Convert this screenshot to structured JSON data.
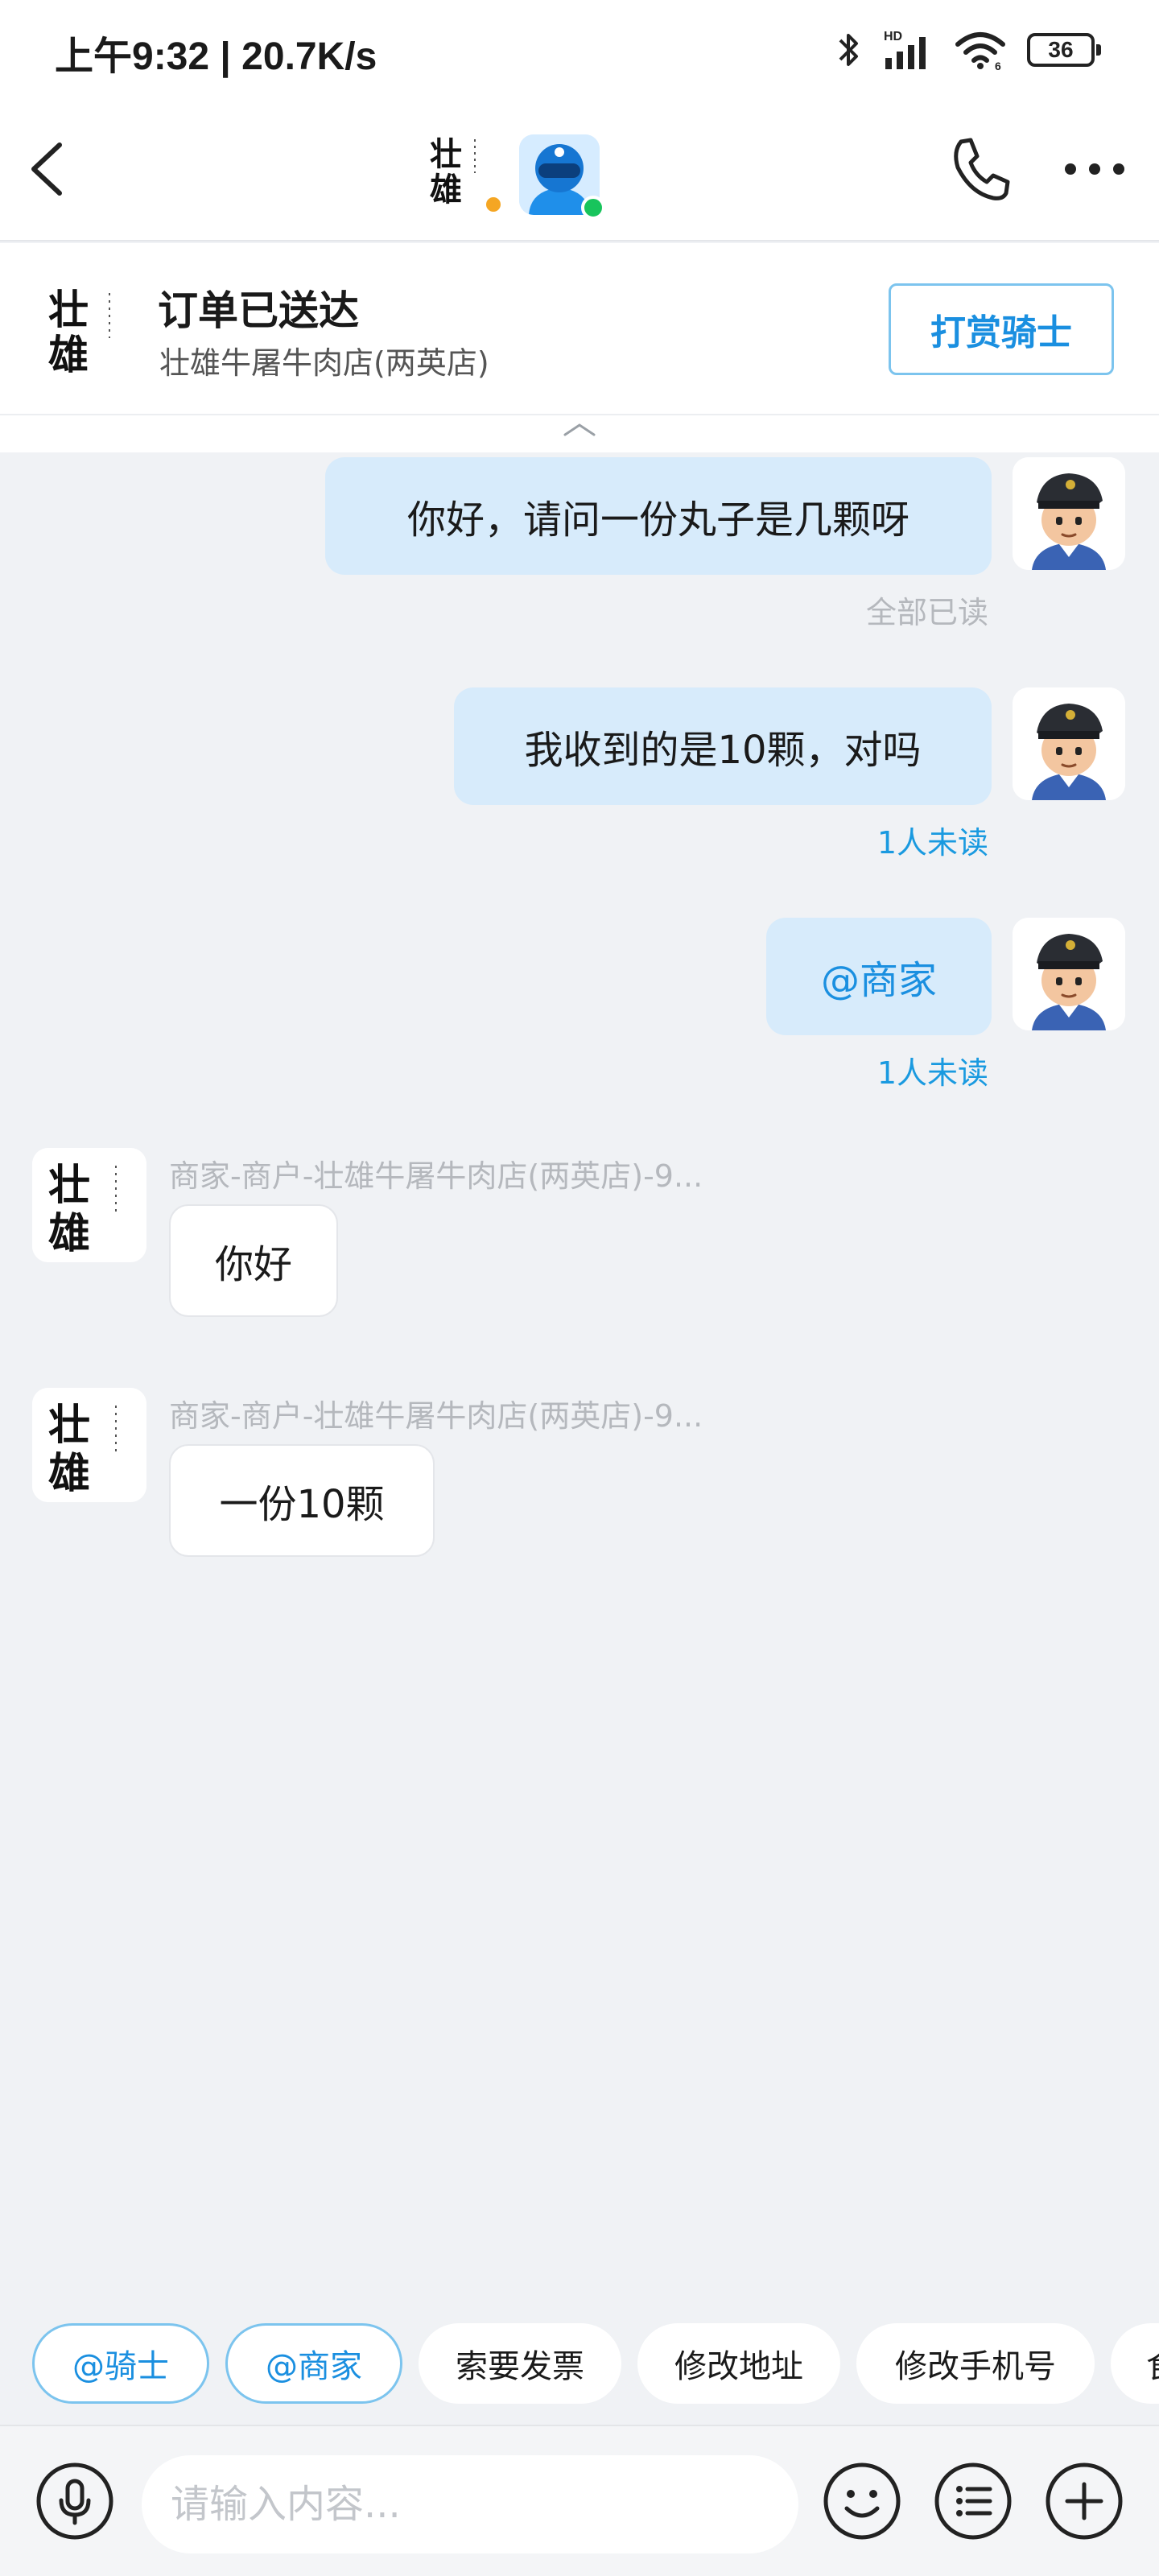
{
  "status_bar": {
    "time_text": "上午9:32 | 20.7K/s",
    "battery_level": "36",
    "icons": [
      "bluetooth-icon",
      "signal-hd-icon",
      "wifi-icon",
      "battery-icon"
    ]
  },
  "header": {
    "store_logo_text": "壮雄",
    "merchant_status": "busy",
    "rider_status": "online",
    "icons": [
      "back-icon",
      "phone-icon",
      "more-icon"
    ]
  },
  "order_card": {
    "logo_text": "壮雄",
    "status_title": "订单已送达",
    "store_name": "壮雄牛屠牛肉店(两英店)",
    "tip_button_label": "打赏骑士"
  },
  "messages": [
    {
      "direction": "out",
      "text": "你好，请问一份丸子是几颗呀",
      "read_status": "全部已读"
    },
    {
      "direction": "out",
      "text": "我收到的是10颗，对吗",
      "read_status": "1人未读"
    },
    {
      "direction": "out",
      "text": "@商家",
      "read_status": "1人未读",
      "is_mention": true
    },
    {
      "direction": "in",
      "sender": "商家-商户-壮雄牛屠牛肉店(两英店)-9...",
      "text": "你好"
    },
    {
      "direction": "in",
      "sender": "商家-商户-壮雄牛屠牛肉店(两英店)-9...",
      "text": "一份10颗"
    }
  ],
  "quick_actions": [
    {
      "label": "@骑士",
      "style": "mention"
    },
    {
      "label": "@商家",
      "style": "mention"
    },
    {
      "label": "索要发票",
      "style": "normal"
    },
    {
      "label": "修改地址",
      "style": "normal"
    },
    {
      "label": "修改手机号",
      "style": "normal"
    },
    {
      "label": "食",
      "style": "normal"
    }
  ],
  "input": {
    "placeholder": "请输入内容..."
  },
  "colors": {
    "accent_blue": "#1a8fe0",
    "outgoing_bubble": "#d7ebfb",
    "background": "#f0f2f5",
    "online_green": "#18c45c",
    "busy_yellow": "#f5a623"
  }
}
